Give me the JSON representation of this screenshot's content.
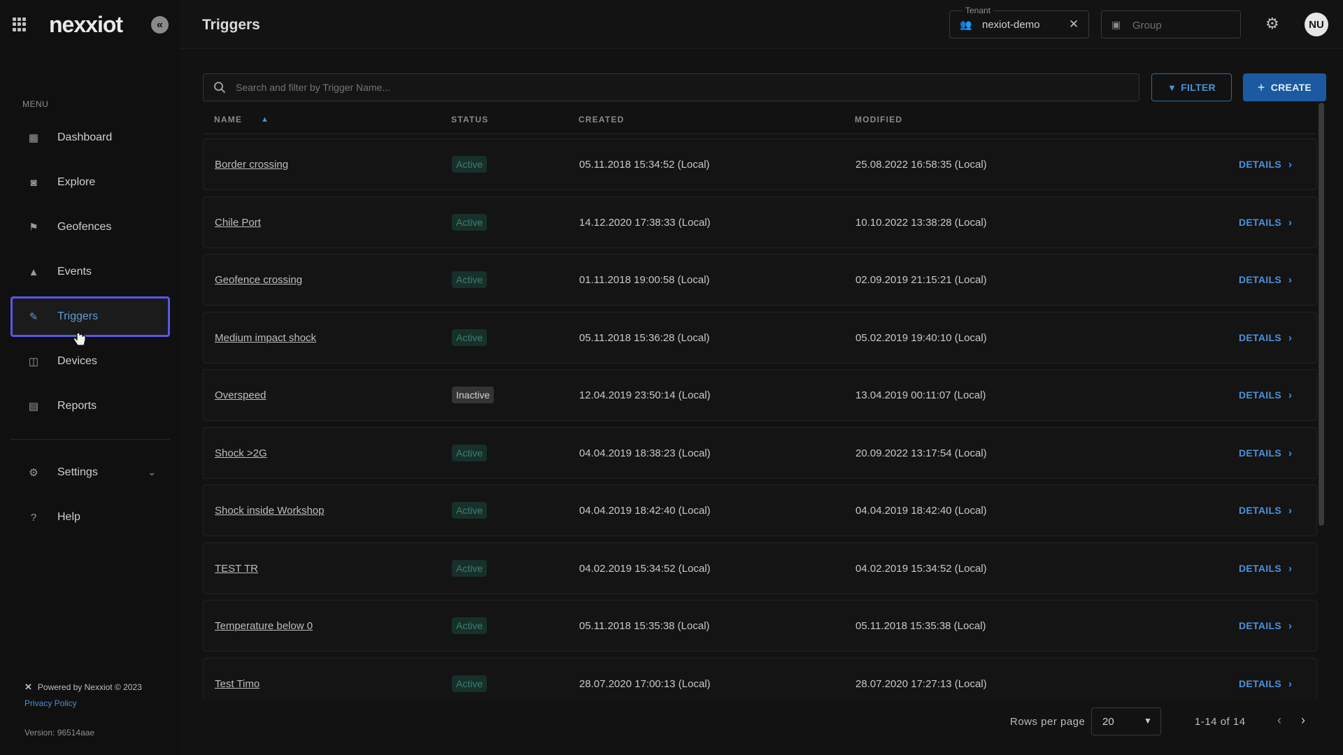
{
  "sidebar": {
    "logo": "nexxiot",
    "menu_heading": "MENU",
    "items": [
      {
        "label": "Dashboard",
        "icon": "dashboard-icon",
        "glyph": "▦"
      },
      {
        "label": "Explore",
        "icon": "binoculars-icon",
        "glyph": "◙"
      },
      {
        "label": "Geofences",
        "icon": "flag-icon",
        "glyph": "⚑"
      },
      {
        "label": "Events",
        "icon": "warning-icon",
        "glyph": "▲"
      },
      {
        "label": "Triggers",
        "icon": "pencil-icon",
        "glyph": "✎"
      },
      {
        "label": "Devices",
        "icon": "cast-icon",
        "glyph": "◫"
      },
      {
        "label": "Reports",
        "icon": "document-icon",
        "glyph": "▤"
      }
    ],
    "settings": {
      "label": "Settings",
      "icon": "gear-icon",
      "glyph": "⚙"
    },
    "help": {
      "label": "Help",
      "icon": "help-icon",
      "glyph": "?"
    },
    "footer": {
      "powered_by": "Powered by Nexxiot © 2023",
      "privacy": "Privacy Policy",
      "version": "Version: 96514aae"
    }
  },
  "header": {
    "title": "Triggers",
    "tenant": {
      "legend": "Tenant",
      "value": "nexiot-demo"
    },
    "group": {
      "placeholder": "Group"
    },
    "avatar": "NU"
  },
  "toolbar": {
    "search_placeholder": "Search and filter by Trigger Name...",
    "filter_label": "FILTER",
    "create_label": "CREATE"
  },
  "table": {
    "columns": {
      "name": "NAME",
      "status": "STATUS",
      "created": "CREATED",
      "modified": "MODIFIED"
    },
    "details_label": "DETAILS",
    "rows": [
      {
        "name": "Border crossing",
        "status": "Active",
        "created": "05.11.2018 15:34:52 (Local)",
        "modified": "25.08.2022 16:58:35 (Local)"
      },
      {
        "name": "Chile Port",
        "status": "Active",
        "created": "14.12.2020 17:38:33 (Local)",
        "modified": "10.10.2022 13:38:28 (Local)"
      },
      {
        "name": "Geofence crossing",
        "status": "Active",
        "created": "01.11.2018 19:00:58 (Local)",
        "modified": "02.09.2019 21:15:21 (Local)"
      },
      {
        "name": "Medium impact shock",
        "status": "Active",
        "created": "05.11.2018 15:36:28 (Local)",
        "modified": "05.02.2019 19:40:10 (Local)"
      },
      {
        "name": "Overspeed",
        "status": "Inactive",
        "created": "12.04.2019 23:50:14 (Local)",
        "modified": "13.04.2019 00:11:07 (Local)"
      },
      {
        "name": "Shock >2G",
        "status": "Active",
        "created": "04.04.2019 18:38:23 (Local)",
        "modified": "20.09.2022 13:17:54 (Local)"
      },
      {
        "name": "Shock inside Workshop",
        "status": "Active",
        "created": "04.04.2019 18:42:40 (Local)",
        "modified": "04.04.2019 18:42:40 (Local)"
      },
      {
        "name": "TEST TR",
        "status": "Active",
        "created": "04.02.2019 15:34:52 (Local)",
        "modified": "04.02.2019 15:34:52 (Local)"
      },
      {
        "name": "Temperature below 0",
        "status": "Active",
        "created": "05.11.2018 15:35:38 (Local)",
        "modified": "05.11.2018 15:35:38 (Local)"
      },
      {
        "name": "Test Timo",
        "status": "Active",
        "created": "28.07.2020 17:00:13 (Local)",
        "modified": "28.07.2020 17:27:13 (Local)"
      }
    ]
  },
  "pagination": {
    "rows_per_page_label": "Rows per page",
    "rows_per_page_value": "20",
    "range": "1-14 of 14"
  },
  "colors": {
    "accent": "#4a92dc",
    "active_highlight": "#5b56e8",
    "status_active": "#3e7f73"
  }
}
